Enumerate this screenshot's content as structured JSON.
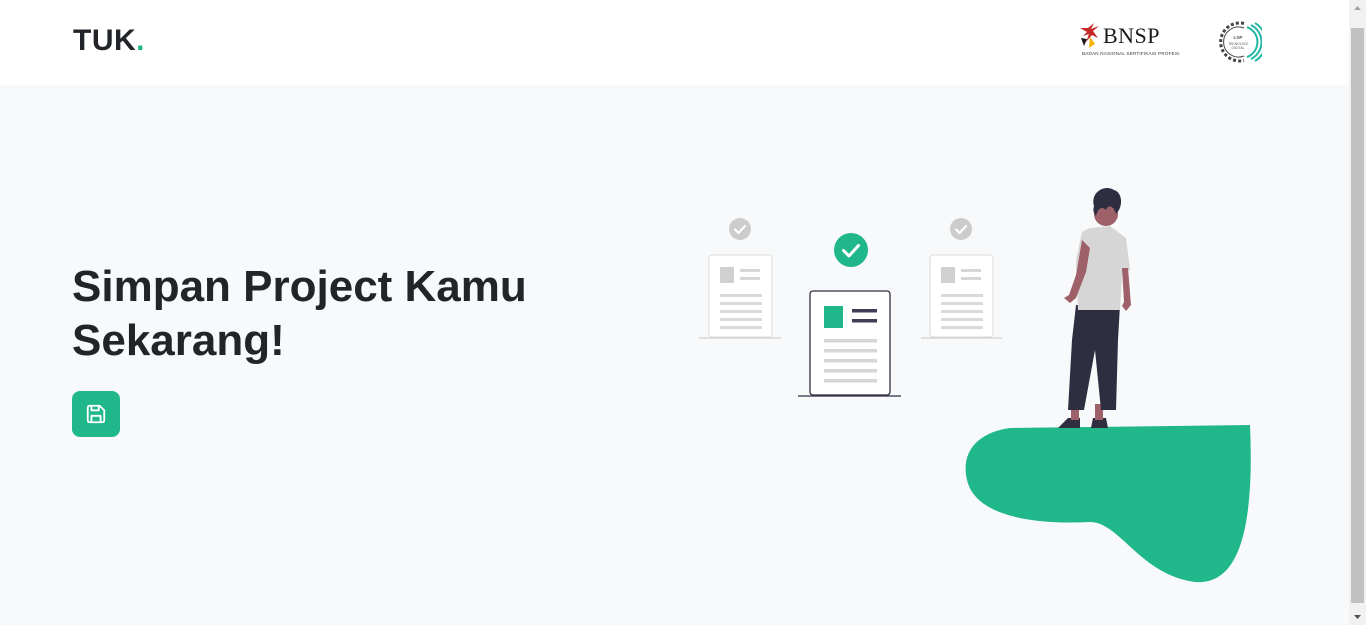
{
  "header": {
    "brand": {
      "text": "TUK",
      "dot": "."
    },
    "logos": {
      "bnsp": {
        "name": "BNSP",
        "subtitle": "BADAN NASIONAL SERTIFIKASI PROFESI"
      },
      "lsp": {
        "line1": "LSP",
        "line2": "TEKNOLOGI DIGITAL"
      }
    }
  },
  "hero": {
    "title_line1": "Simpan Project Kamu",
    "title_line2": "Sekarang!",
    "save_button_icon": "floppy-disk-icon"
  },
  "illustration": {
    "icon": "person-with-documents-illustration"
  },
  "colors": {
    "accent": "#20b78b",
    "text": "#212529",
    "background": "#f8f9fa",
    "header_background": "#ffffff"
  }
}
